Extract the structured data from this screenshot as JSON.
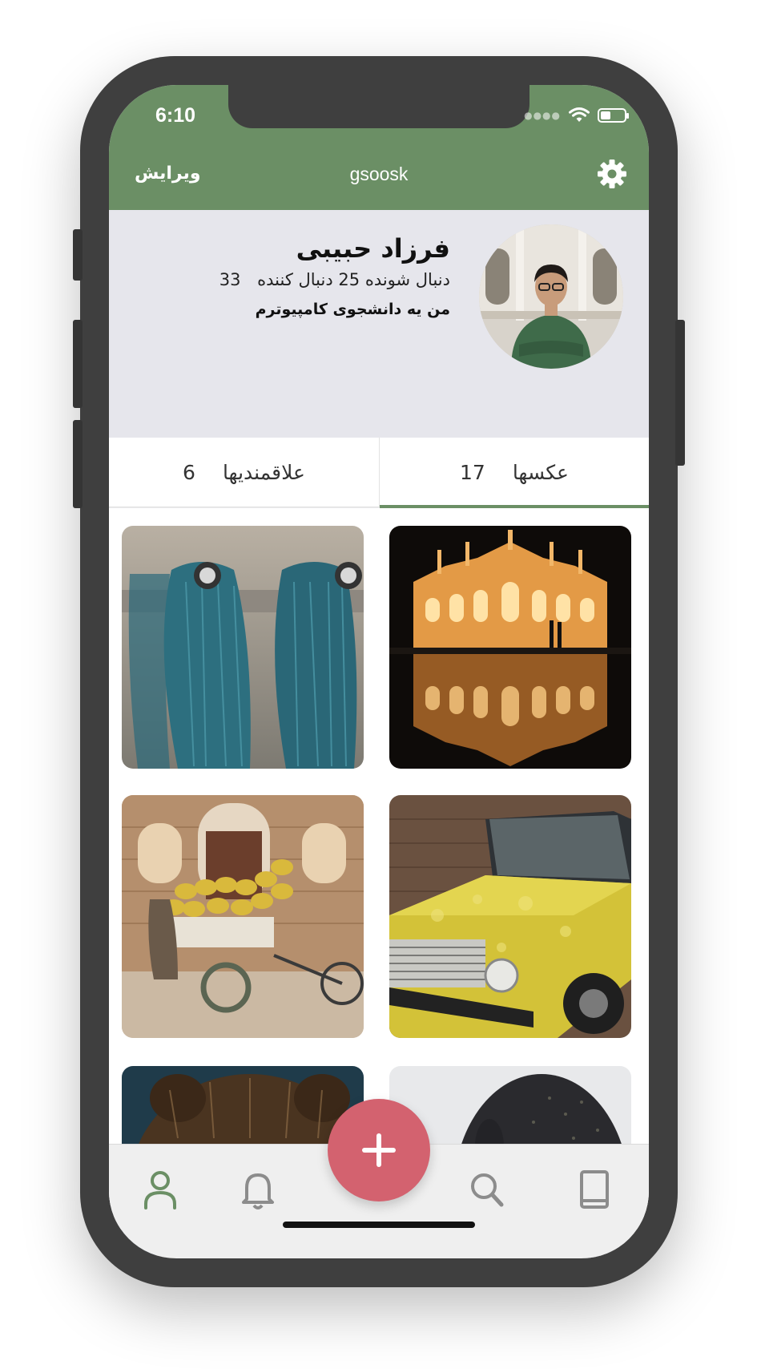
{
  "status_bar": {
    "time": "6:10"
  },
  "nav": {
    "edit_label": "ویرایش",
    "title": "gsoosk",
    "settings_icon": "gear-icon"
  },
  "profile": {
    "name": "فرزاد حبیبی",
    "followers": "25 دنبال کننده",
    "following": "33 دنبال شونده",
    "bio": "من یه دانشجوی کامپیوترم"
  },
  "tabs": [
    {
      "label": "عکسها",
      "count": "17",
      "active": true
    },
    {
      "label": "علاقمندیها",
      "count": "6",
      "active": false
    }
  ],
  "photos": [
    {
      "subject": "palace-reflection-at-night"
    },
    {
      "subject": "blue-yarn-drying"
    },
    {
      "subject": "yellow-paykan-car"
    },
    {
      "subject": "banana-cart-vendor"
    },
    {
      "subject": "dark-haired-head"
    },
    {
      "subject": "bear-fur"
    }
  ],
  "tab_bar": {
    "items": [
      "user-icon",
      "bell-icon",
      "add-icon",
      "search-icon",
      "book-icon"
    ],
    "active": "user-icon",
    "fab_color": "#d3626f"
  },
  "colors": {
    "brand": "#6b8f65",
    "accent": "#d3626f"
  }
}
